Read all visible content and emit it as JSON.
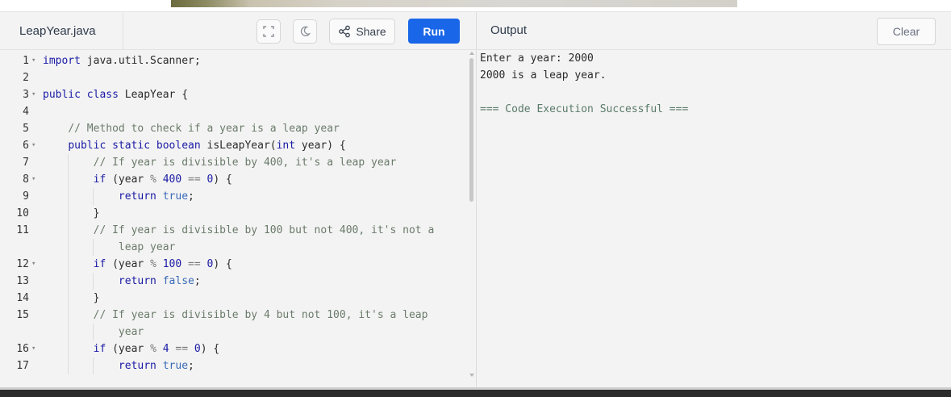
{
  "editor": {
    "filename": "LeapYear.java",
    "share_label": "Share",
    "run_label": "Run",
    "icons": {
      "fullscreen": "fullscreen-icon",
      "theme": "moon-icon",
      "share": "share-icon"
    }
  },
  "code_lines": [
    {
      "n": "1",
      "fold": true,
      "html": "<span class=\"kw\">import</span> java.util.Scanner;"
    },
    {
      "n": "2",
      "fold": false,
      "html": ""
    },
    {
      "n": "3",
      "fold": true,
      "html": "<span class=\"kw\">public class</span> LeapYear {"
    },
    {
      "n": "4",
      "fold": false,
      "html": ""
    },
    {
      "n": "5",
      "fold": false,
      "html": "    <span class=\"cm\">// Method to check if a year is a leap year</span>"
    },
    {
      "n": "6",
      "fold": true,
      "html": "    <span class=\"kw\">public static boolean</span> isLeapYear(<span class=\"kw\">int</span> year) {"
    },
    {
      "n": "7",
      "fold": false,
      "html": "        <span class=\"cm\">// If year is divisible by 400, it's a leap year</span>"
    },
    {
      "n": "8",
      "fold": true,
      "html": "        <span class=\"kw\">if</span> (year <span class=\"op\">%</span> <span class=\"num\">400</span> <span class=\"op\">==</span> <span class=\"num\">0</span>) {"
    },
    {
      "n": "9",
      "fold": false,
      "html": "            <span class=\"kw\">return</span> <span class=\"bool\">true</span>;"
    },
    {
      "n": "10",
      "fold": false,
      "html": "        }"
    },
    {
      "n": "11",
      "fold": false,
      "html": "        <span class=\"cm\">// If year is divisible by 100 but not 400, it's not a</span>"
    },
    {
      "n": "",
      "fold": false,
      "html": "            <span class=\"cm\">leap year</span>"
    },
    {
      "n": "12",
      "fold": true,
      "html": "        <span class=\"kw\">if</span> (year <span class=\"op\">%</span> <span class=\"num\">100</span> <span class=\"op\">==</span> <span class=\"num\">0</span>) {"
    },
    {
      "n": "13",
      "fold": false,
      "html": "            <span class=\"kw\">return</span> <span class=\"bool\">false</span>;"
    },
    {
      "n": "14",
      "fold": false,
      "html": "        }"
    },
    {
      "n": "15",
      "fold": false,
      "html": "        <span class=\"cm\">// If year is divisible by 4 but not 100, it's a leap</span>"
    },
    {
      "n": "",
      "fold": false,
      "html": "            <span class=\"cm\">year</span>"
    },
    {
      "n": "16",
      "fold": true,
      "html": "        <span class=\"kw\">if</span> (year <span class=\"op\">%</span> <span class=\"num\">4</span> <span class=\"op\">==</span> <span class=\"num\">0</span>) {"
    },
    {
      "n": "17",
      "fold": false,
      "html": "            <span class=\"kw\">return</span> <span class=\"bool\">true</span>;"
    }
  ],
  "output": {
    "title": "Output",
    "clear_label": "Clear",
    "lines": [
      "Enter a year: 2000",
      "2000 is a leap year.",
      "",
      "=== Code Execution Successful ==="
    ]
  }
}
